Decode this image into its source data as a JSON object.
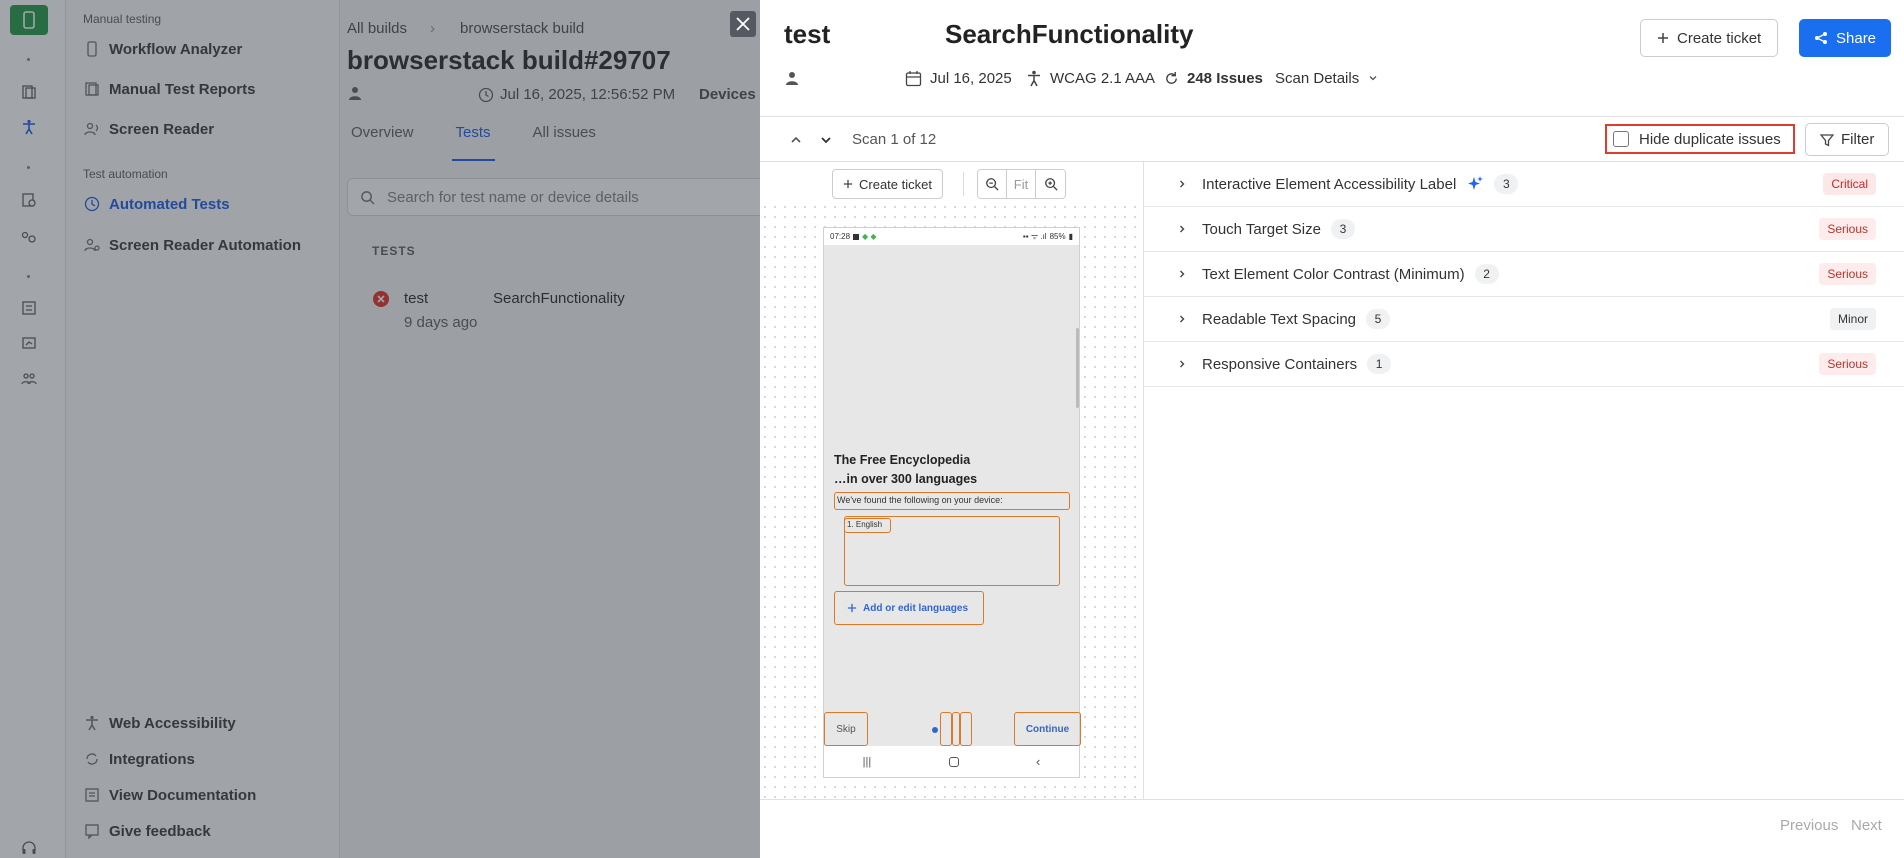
{
  "rail": {
    "icons": [
      "app-logo-icon",
      "clipboard-icon",
      "accessibility-icon",
      "files-icon",
      "network-icon",
      "list-icon",
      "chart-icon",
      "people-icon",
      "headset-icon"
    ]
  },
  "sidebar": {
    "section_manual": "Manual testing",
    "section_automation": "Test automation",
    "items": [
      {
        "label": "Workflow Analyzer",
        "icon": "mobile-icon"
      },
      {
        "label": "Manual Test Reports",
        "icon": "report-icon"
      },
      {
        "label": "Screen Reader",
        "icon": "screen-reader-icon"
      },
      {
        "label": "Automated Tests",
        "icon": "automated-icon"
      },
      {
        "label": "Screen Reader Automation",
        "icon": "screen-reader-auto-icon"
      },
      {
        "label": "Web Accessibility",
        "icon": "accessibility-icon"
      },
      {
        "label": "Integrations",
        "icon": "integrations-icon"
      },
      {
        "label": "View Documentation",
        "icon": "doc-icon"
      },
      {
        "label": "Give feedback",
        "icon": "feedback-icon"
      }
    ]
  },
  "main": {
    "breadcrumb": {
      "root": "All builds",
      "sep": "›",
      "current": "browserstack build"
    },
    "title": "browserstack build#29707",
    "timestamp": "Jul 16, 2025, 12:56:52 PM",
    "devices_label": "Devices",
    "tabs": [
      {
        "label": "Overview"
      },
      {
        "label": "Tests"
      },
      {
        "label": "All issues"
      }
    ],
    "search_placeholder": "Search for test name or device details",
    "tests_header": "TESTS",
    "test": {
      "name": "test",
      "suite": "SearchFunctionality",
      "time": "9 days ago"
    }
  },
  "drawer": {
    "test_name": "test",
    "suite_name": "SearchFunctionality",
    "create_ticket": "Create ticket",
    "share": "Share",
    "date": "Jul 16, 2025",
    "standard": "WCAG 2.1 AAA",
    "issues_count": "248 Issues",
    "scan_details": "Scan Details",
    "scan_label": "Scan 1 of 12",
    "hide_duplicates": "Hide duplicate issues",
    "filter": "Filter",
    "preview": {
      "create_ticket": "Create ticket",
      "fit": "Fit",
      "status_time": "07:28",
      "battery": "85%",
      "headline_1": "The Free Encyclopedia",
      "headline_2": "…in over 300 languages",
      "found_text": "We've found the following on your device:",
      "lang_item": "1.   English",
      "add_languages": "Add or edit languages",
      "skip": "Skip",
      "continue": "Continue"
    },
    "issues": [
      {
        "name": "Interactive Element Accessibility Label",
        "count": "3",
        "severity": "Critical",
        "ai": true
      },
      {
        "name": "Touch Target Size",
        "count": "3",
        "severity": "Serious"
      },
      {
        "name": "Text Element Color Contrast (Minimum)",
        "count": "2",
        "severity": "Serious"
      },
      {
        "name": "Readable Text Spacing",
        "count": "5",
        "severity": "Minor"
      },
      {
        "name": "Responsive Containers",
        "count": "1",
        "severity": "Serious"
      }
    ],
    "previous": "Previous",
    "next": "Next"
  },
  "colors": {
    "primary": "#1a6ff0",
    "highlight": "#e03b2c",
    "logo": "#2e9e50",
    "critical": "#c62828"
  }
}
